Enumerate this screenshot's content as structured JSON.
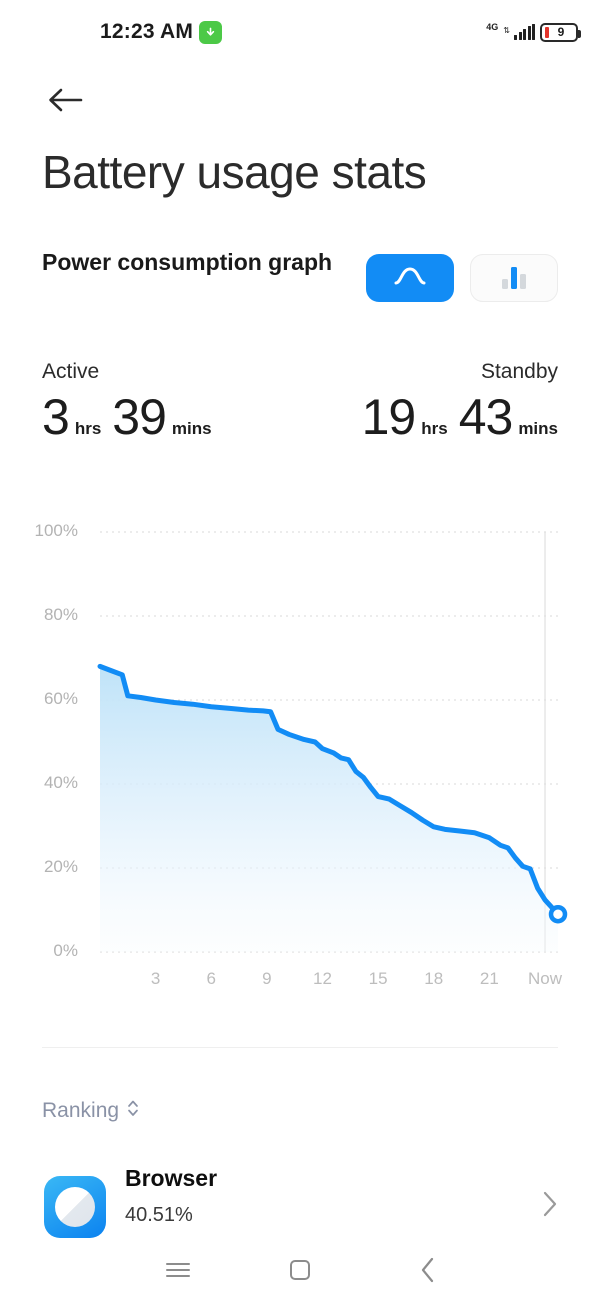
{
  "status_bar": {
    "time": "12:23 AM",
    "download_icon": "download-arrow-icon",
    "network_type": "4G",
    "signal_icon": "signal-bars-icon",
    "battery_level": "9",
    "battery_icon": "battery-low-icon"
  },
  "header": {
    "back_icon": "back-arrow-icon",
    "title": "Battery usage stats"
  },
  "section": {
    "heading": "Power consumption graph",
    "toggle_line": {
      "icon": "line-graph-icon",
      "label": "Line graph",
      "selected": true,
      "accent": "#128cf5"
    },
    "toggle_bar": {
      "icon": "bar-graph-icon",
      "label": "Bar graph",
      "selected": false
    }
  },
  "stats": {
    "active": {
      "label": "Active",
      "hours": "3",
      "hours_unit": "hrs",
      "minutes": "39",
      "minutes_unit": "mins"
    },
    "standby": {
      "label": "Standby",
      "hours": "19",
      "hours_unit": "hrs",
      "minutes": "43",
      "minutes_unit": "mins"
    }
  },
  "chart_data": {
    "type": "area",
    "title": "Power consumption graph",
    "xlabel": "",
    "ylabel": "",
    "ylim": [
      0,
      100
    ],
    "grid": true,
    "legend": false,
    "line_color": "#128cf5",
    "fill_color": "#bfe3f8",
    "y_ticks": [
      "0%",
      "20%",
      "40%",
      "60%",
      "80%",
      "100%"
    ],
    "y_tick_values": [
      0,
      20,
      40,
      60,
      80,
      100
    ],
    "x_ticks": [
      "3",
      "6",
      "9",
      "12",
      "15",
      "18",
      "21",
      "Now"
    ],
    "x_tick_values": [
      3,
      6,
      9,
      12,
      15,
      18,
      21,
      24
    ],
    "now_marker": "Now",
    "end_point_value": 9,
    "x": [
      0,
      0.6,
      1.2,
      1.5,
      2.2,
      3,
      4,
      5,
      6,
      7,
      8,
      8.8,
      9.2,
      9.6,
      10.2,
      11,
      11.6,
      12,
      12.6,
      13,
      13.4,
      13.8,
      14.2,
      14.6,
      15,
      15.6,
      16.2,
      16.8,
      17.4,
      18,
      18.6,
      19.4,
      20.2,
      21,
      21.6,
      22,
      22.4,
      22.8,
      23.2,
      23.6,
      24,
      24.7
    ],
    "values": [
      68,
      67,
      66,
      61,
      60.6,
      60,
      59.4,
      59,
      58.4,
      58,
      57.6,
      57.4,
      57.2,
      53,
      51.8,
      50.6,
      50,
      48.4,
      47.4,
      46.2,
      45.8,
      43,
      41.6,
      39.2,
      37,
      36.4,
      34.8,
      33.2,
      31.4,
      29.8,
      29.2,
      28.8,
      28.4,
      27.2,
      25.4,
      24.8,
      22.4,
      20.4,
      19.8,
      15.2,
      12.4,
      9
    ]
  },
  "ranking": {
    "label": "Ranking",
    "sort_icon": "sort-updown-icon"
  },
  "app_list": [
    {
      "icon": "browser-app-icon",
      "name": "Browser",
      "percent": "40.51%",
      "chevron_icon": "chevron-right-icon"
    }
  ],
  "nav_bar": {
    "recents_icon": "menu-recents-icon",
    "home_icon": "home-square-icon",
    "back_icon": "chevron-left-icon"
  }
}
